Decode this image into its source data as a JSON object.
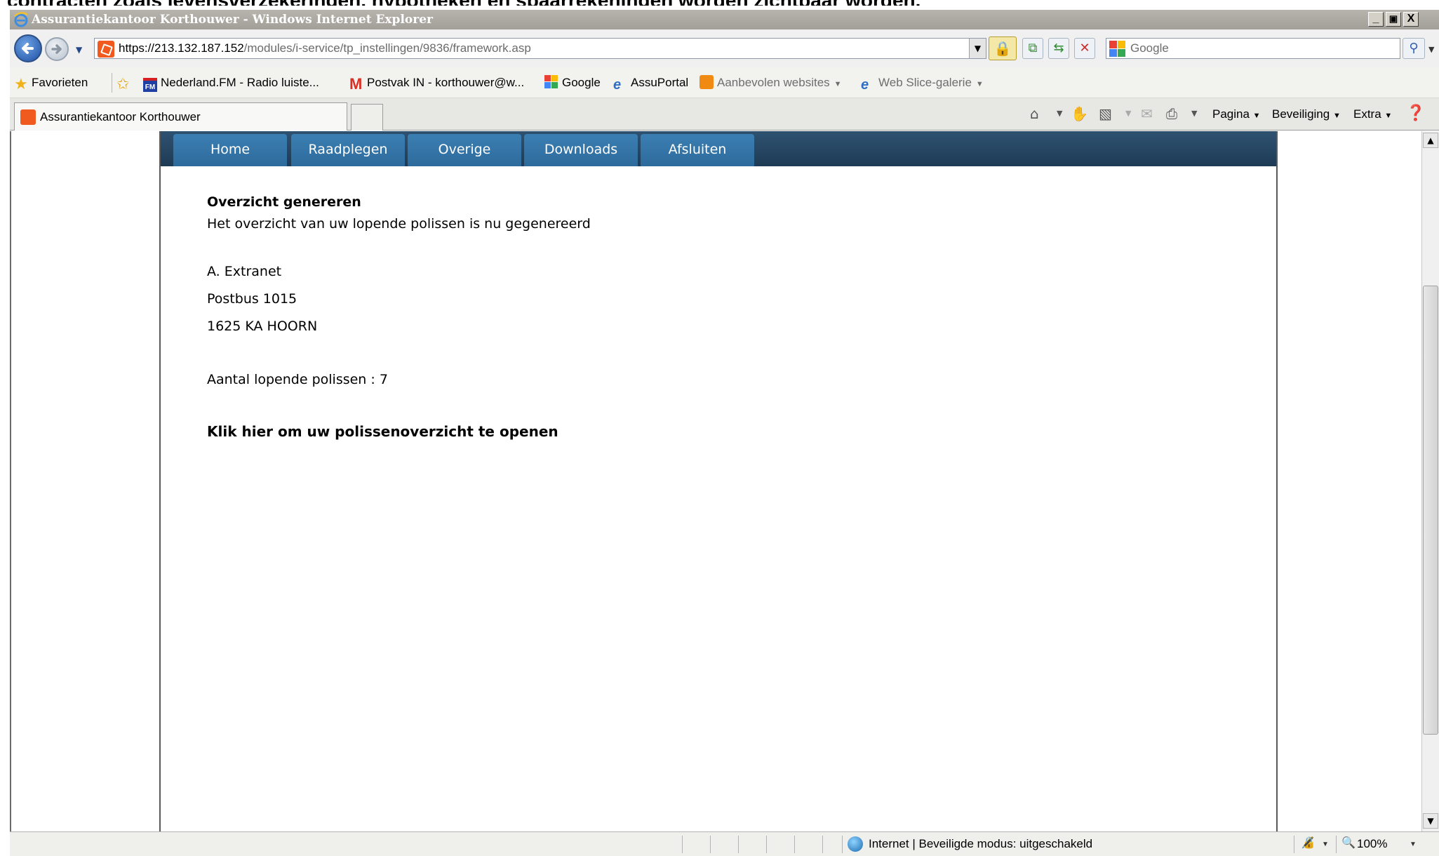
{
  "caption_cutoff": "contracten zoals levensverzekeringen, hypotheken en spaarrekeningen worden zichtbaar worden.",
  "window": {
    "title": "Assurantiekantoor Korthouwer - Windows Internet Explorer",
    "controls": {
      "minimize": "_",
      "restore": "▣",
      "close": "X"
    }
  },
  "address": {
    "url_host": "https://213.132.187.152",
    "url_path": "/modules/i-service/tp_instellingen/9836/framework.asp",
    "search_placeholder": "Google"
  },
  "favorites": {
    "label": "Favorieten",
    "items": [
      {
        "label": "Nederland.FM - Radio luiste...",
        "icon": "radio-fm-icon"
      },
      {
        "label": "Postvak IN - korthouwer@w...",
        "icon": "gmail-icon"
      },
      {
        "label": "Google",
        "icon": "google-icon"
      },
      {
        "label": "AssuPortal",
        "icon": "ie-page-icon"
      },
      {
        "label": "Aanbevolen websites",
        "icon": "suggested-sites-icon"
      },
      {
        "label": "Web Slice-galerie",
        "icon": "ie-page-icon"
      }
    ]
  },
  "tabs": {
    "active_label": "Assurantiekantoor Korthouwer"
  },
  "command_bar": {
    "page": "Pagina",
    "safety": "Beveiliging",
    "tools": "Extra"
  },
  "site_nav": [
    "Home",
    "Raadplegen",
    "Overige",
    "Downloads",
    "Afsluiten"
  ],
  "content": {
    "heading": "Overzicht genereren",
    "message": "Het overzicht van uw lopende polissen is nu gegenereerd",
    "address_name": "A. Extranet",
    "address_line1": "Postbus 1015",
    "address_line2": "1625 KA HOORN",
    "policy_count_label": "Aantal lopende polissen : 7",
    "open_link": "Klik hier om uw polissenoverzicht te openen"
  },
  "status": {
    "zone": "Internet | Beveiligde modus: uitgeschakeld",
    "zoom": "100%"
  },
  "colors": {
    "nav_bar": "#1e3b55",
    "nav_tab": "#3b7fb2",
    "title_bar": "#a19f98"
  }
}
